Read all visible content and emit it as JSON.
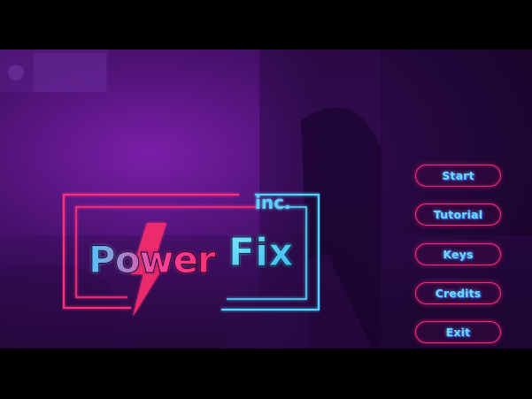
{
  "game": {
    "logo": {
      "wordmark_a": "Power",
      "wordmark_b": "Fix",
      "suffix": "inc."
    },
    "menu": [
      {
        "id": "start",
        "label": "Start"
      },
      {
        "id": "tutorial",
        "label": "Tutorial"
      },
      {
        "id": "keys",
        "label": "Keys"
      },
      {
        "id": "credits",
        "label": "Credits"
      },
      {
        "id": "exit",
        "label": "Exit"
      }
    ]
  },
  "colors": {
    "neon_pink": "#ff2e78",
    "neon_cyan": "#4fd6ff",
    "background_purple": "#3a0f5e",
    "letterbox": "#000000"
  }
}
